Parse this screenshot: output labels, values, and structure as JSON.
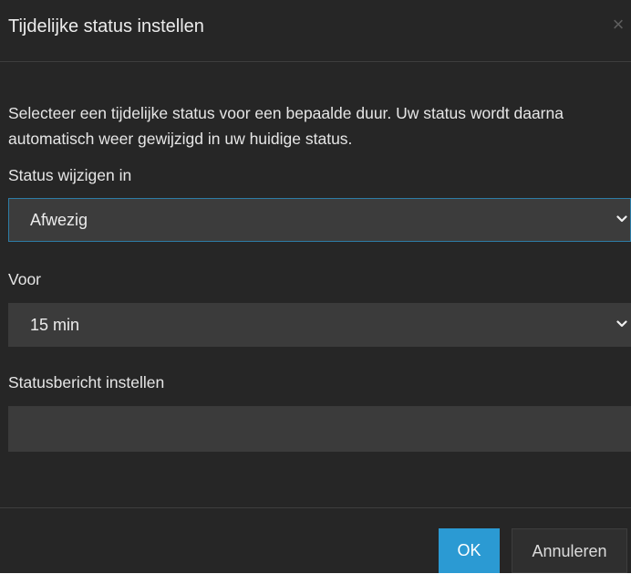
{
  "dialog": {
    "title": "Tijdelijke status instellen",
    "close_label": "×",
    "description": "Selecteer een tijdelijke status voor een bepaalde duur. Uw status wordt daarna automatisch weer gewijzigd in uw huidige status.",
    "status": {
      "label": "Status wijzigen in",
      "selected": "Afwezig"
    },
    "duration": {
      "label": "Voor",
      "selected": "15 min"
    },
    "message": {
      "label": "Statusbericht instellen",
      "value": ""
    },
    "buttons": {
      "ok": "OK",
      "cancel": "Annuleren"
    },
    "colors": {
      "background": "#262626",
      "field": "#3b3b3b",
      "primary": "#2b9ad3",
      "focus_border": "#2d7ca6"
    },
    "icons": {
      "close": "close-icon",
      "dropdown": "chevron-down-icon"
    }
  }
}
